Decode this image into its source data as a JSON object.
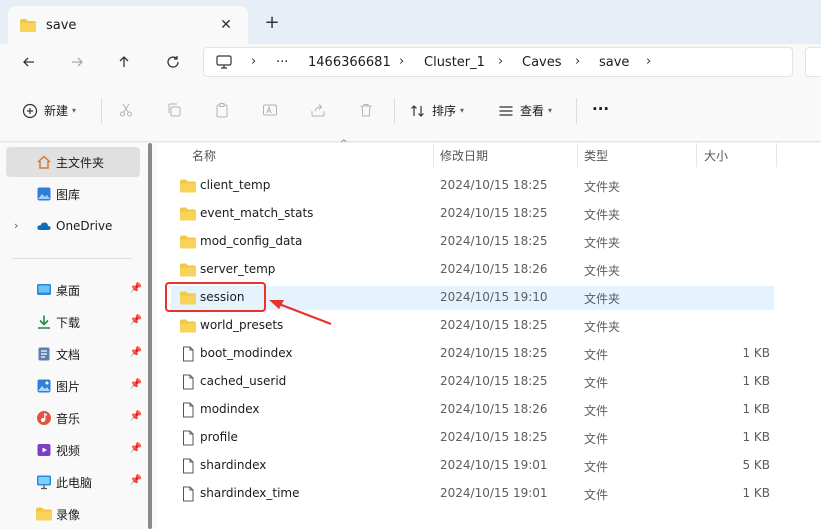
{
  "window": {
    "tab_title": "save",
    "new_tab_symbol": "+",
    "close_symbol": "✕"
  },
  "address": {
    "overflow": "···",
    "crumbs": [
      "1466366681",
      "Cluster_1",
      "Caves",
      "save"
    ],
    "separator": "›"
  },
  "toolbar": {
    "new_label": "新建",
    "sort_label": "排序",
    "view_label": "查看",
    "more_symbol": "···"
  },
  "sidebar": {
    "items": [
      {
        "label": "主文件夹",
        "icon": "home-icon"
      },
      {
        "label": "图库",
        "icon": "gallery-icon"
      },
      {
        "label": "OneDrive",
        "icon": "cloud-icon"
      },
      {
        "label": "桌面",
        "icon": "desktop-icon"
      },
      {
        "label": "下载",
        "icon": "download-icon"
      },
      {
        "label": "文档",
        "icon": "document-icon"
      },
      {
        "label": "图片",
        "icon": "pictures-icon"
      },
      {
        "label": "音乐",
        "icon": "music-icon"
      },
      {
        "label": "视频",
        "icon": "video-icon"
      },
      {
        "label": "此电脑",
        "icon": "computer-icon"
      },
      {
        "label": "录像",
        "icon": "folder-icon"
      }
    ],
    "expander_symbol": "›",
    "pin_symbol": "📌"
  },
  "columns": {
    "name": "名称",
    "modified": "修改日期",
    "type": "类型",
    "size": "大小"
  },
  "files": [
    {
      "name": "client_temp",
      "modified": "2024/10/15 18:25",
      "type": "文件夹",
      "size": "",
      "kind": "folder"
    },
    {
      "name": "event_match_stats",
      "modified": "2024/10/15 18:25",
      "type": "文件夹",
      "size": "",
      "kind": "folder"
    },
    {
      "name": "mod_config_data",
      "modified": "2024/10/15 18:25",
      "type": "文件夹",
      "size": "",
      "kind": "folder"
    },
    {
      "name": "server_temp",
      "modified": "2024/10/15 18:26",
      "type": "文件夹",
      "size": "",
      "kind": "folder"
    },
    {
      "name": "session",
      "modified": "2024/10/15 19:10",
      "type": "文件夹",
      "size": "",
      "kind": "folder"
    },
    {
      "name": "world_presets",
      "modified": "2024/10/15 18:25",
      "type": "文件夹",
      "size": "",
      "kind": "folder"
    },
    {
      "name": "boot_modindex",
      "modified": "2024/10/15 18:25",
      "type": "文件",
      "size": "1 KB",
      "kind": "file"
    },
    {
      "name": "cached_userid",
      "modified": "2024/10/15 18:25",
      "type": "文件",
      "size": "1 KB",
      "kind": "file"
    },
    {
      "name": "modindex",
      "modified": "2024/10/15 18:26",
      "type": "文件",
      "size": "1 KB",
      "kind": "file"
    },
    {
      "name": "profile",
      "modified": "2024/10/15 18:25",
      "type": "文件",
      "size": "1 KB",
      "kind": "file"
    },
    {
      "name": "shardindex",
      "modified": "2024/10/15 19:01",
      "type": "文件",
      "size": "5 KB",
      "kind": "file"
    },
    {
      "name": "shardindex_time",
      "modified": "2024/10/15 19:01",
      "type": "文件",
      "size": "1 KB",
      "kind": "file"
    }
  ],
  "highlighted_file": "session",
  "colors": {
    "folder": "#f2c744",
    "annotation": "#e8322d",
    "row_highlight": "#e5f3ff",
    "accent": "#0067c0"
  }
}
